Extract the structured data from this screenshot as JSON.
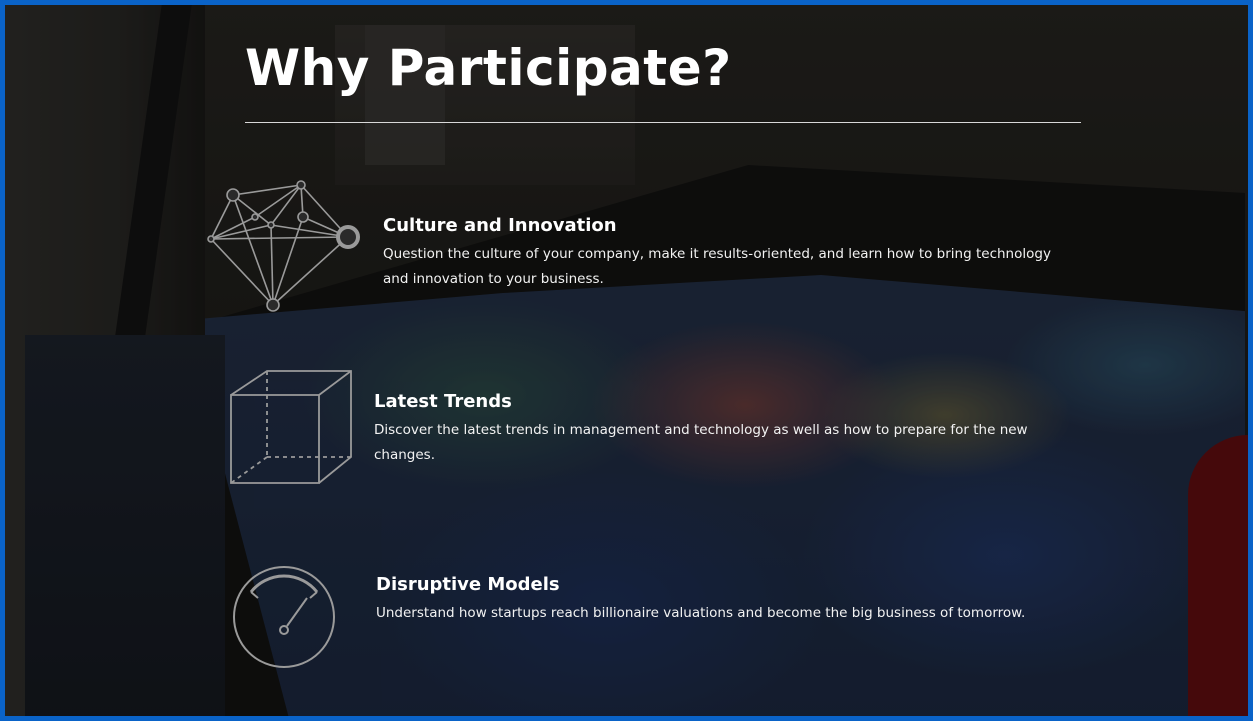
{
  "section": {
    "title": "Why Participate?"
  },
  "features": [
    {
      "title": "Culture and Innovation",
      "description": "Question the culture of your company, make it results-oriented, and learn how to bring technology and innovation to your business.",
      "icon": "network-nodes-icon"
    },
    {
      "title": "Latest Trends",
      "description": "Discover the latest trends in management and technology as well as how to prepare for the new changes.",
      "icon": "wireframe-cube-icon"
    },
    {
      "title": "Disruptive Models",
      "description": "Understand how startups reach billionaire valuations and become the big business of tomorrow.",
      "icon": "speedometer-gauge-icon"
    }
  ],
  "colors": {
    "frame_border": "#0a63c8",
    "text": "#ffffff",
    "icon_stroke": "#9a9a9a"
  }
}
